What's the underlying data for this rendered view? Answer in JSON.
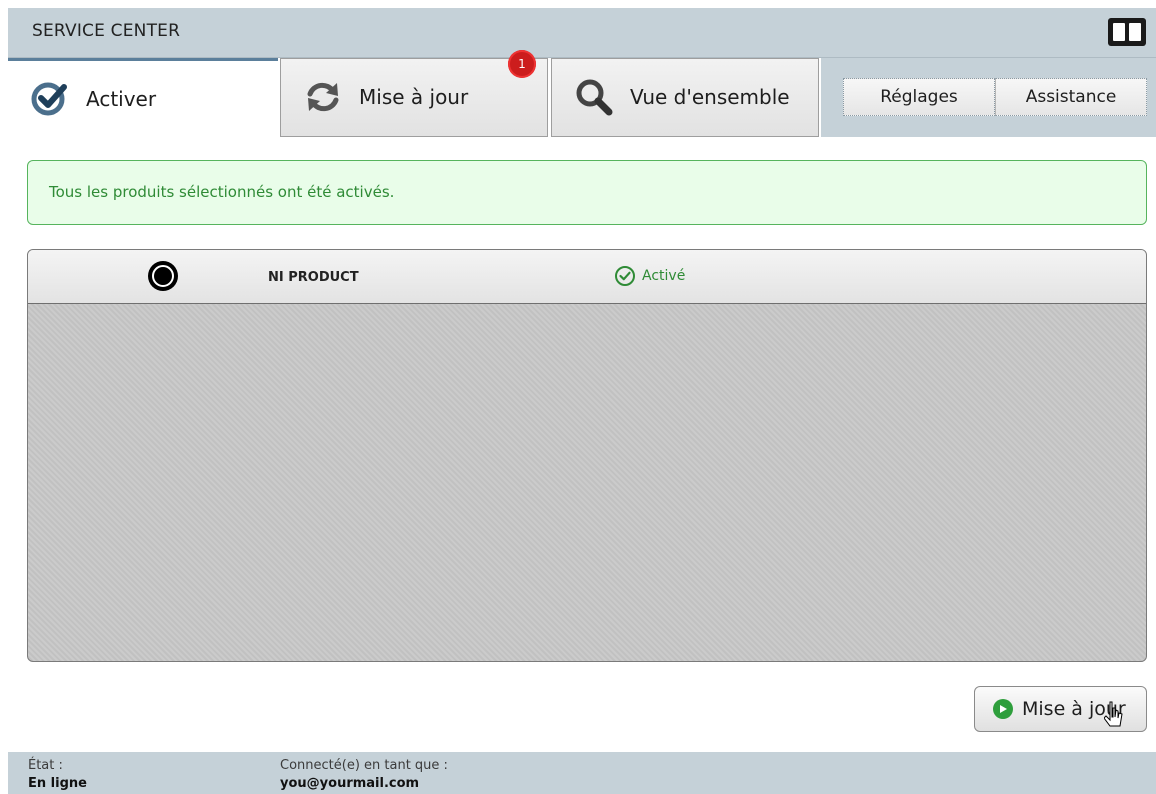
{
  "window": {
    "title": "SERVICE CENTER",
    "logo": "NI"
  },
  "tabs": [
    {
      "label": "Activer",
      "icon": "check-badge-icon",
      "active": true
    },
    {
      "label": "Mise à jour",
      "icon": "refresh-icon",
      "badge": "1"
    },
    {
      "label": "Vue d'ensemble",
      "icon": "magnifier-icon"
    }
  ],
  "side_buttons": {
    "settings": "Réglages",
    "support": "Assistance"
  },
  "notice": {
    "message": "Tous les produits sélectionnés ont été activés."
  },
  "products": [
    {
      "name": "NI PRODUCT",
      "status": "Activé"
    }
  ],
  "action_button": {
    "label": "Mise à jour"
  },
  "statusbar": {
    "state_label": "État :",
    "state_value": "En ligne",
    "user_label": "Connecté(e) en tant que :",
    "user_value": "you@yourmail.com"
  },
  "colors": {
    "accent_green": "#2f8b36",
    "chrome": "#c5d1d8",
    "badge": "#cc1d1d"
  }
}
